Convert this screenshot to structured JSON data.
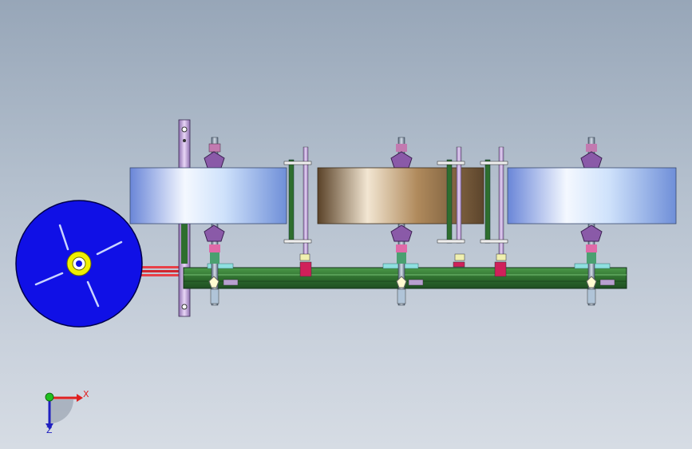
{
  "viewport": {
    "background_top": "#97a6b8",
    "background_bottom": "#d6dce4"
  },
  "model": {
    "reel_color": "#1414e0",
    "reel_hub_color": "#f0f000",
    "frame_color": "#2f7a2f",
    "roller_light_color": "#cfe6ff",
    "roller_bronze_color": "#b8966c",
    "post_color": "#c8a8e0",
    "feed_strip_color": "#e0303a"
  },
  "triad": {
    "x_label": "X",
    "z_label": "Z",
    "x_color": "#e02020",
    "z_color": "#2020c0",
    "y_color": "#20c020"
  }
}
